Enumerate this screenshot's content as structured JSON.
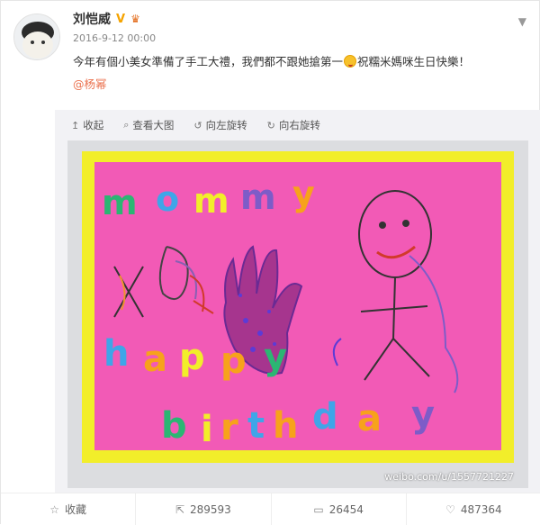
{
  "post": {
    "author": "刘恺威",
    "time": "2016-9-12 00:00",
    "text_before": "今年有個小美女準備了手工大禮，我們都不跟她搶第一",
    "text_after": "祝糯米媽咪生日快樂！",
    "mention": "@杨幂"
  },
  "toolbar": {
    "collapse": "收起",
    "view_large": "查看大图",
    "rotate_left": "向左旋转",
    "rotate_right": "向右旋转"
  },
  "photo": {
    "word1": [
      "m",
      "o",
      "m",
      "m",
      "y"
    ],
    "word2": [
      "h",
      "a",
      "p",
      "p",
      "y"
    ],
    "word3": [
      "b",
      "i",
      "r",
      "t",
      "h",
      "d",
      "a",
      "y"
    ],
    "watermark": "weibo.com/u/1557721227"
  },
  "footer": {
    "favorite": "收藏",
    "repost_count": "289593",
    "comment_count": "26454",
    "like_count": "487364"
  },
  "colors": {
    "accent": "#eb7350",
    "card_pink": "#f25ab6",
    "card_yellow": "#f2ee2a"
  }
}
